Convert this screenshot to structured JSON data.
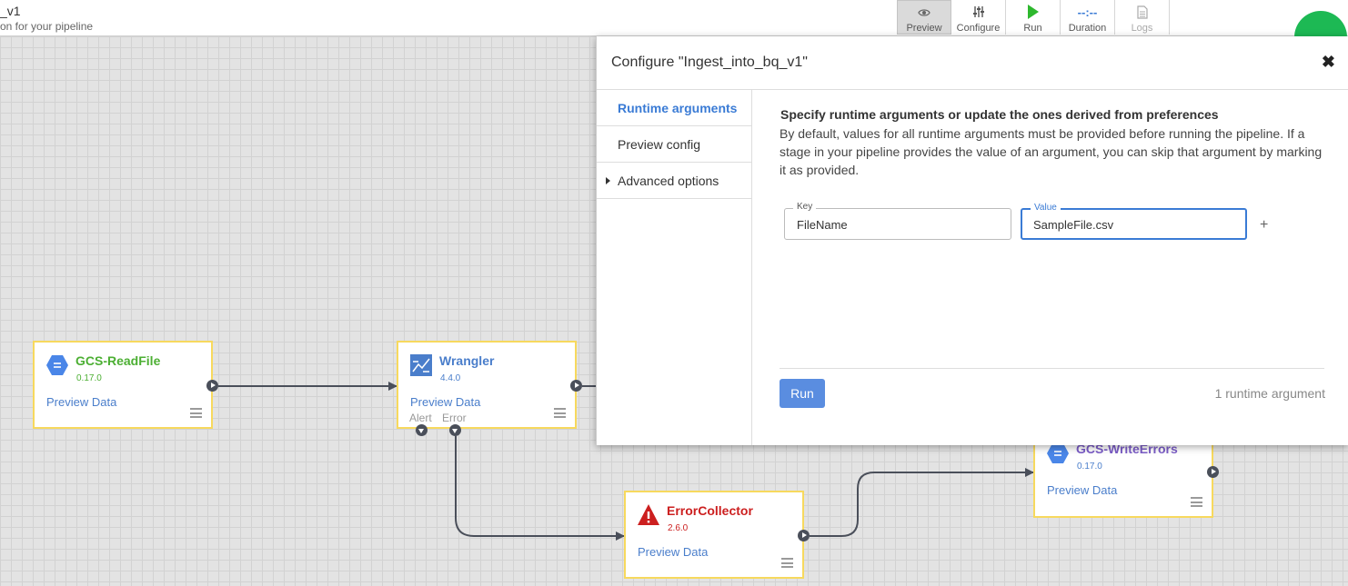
{
  "header": {
    "pipeline_name": "_v1",
    "pipeline_description": "on for your pipeline"
  },
  "toolbar": {
    "items": [
      {
        "label": "Preview",
        "icon": "eye-icon",
        "active": true
      },
      {
        "label": "Configure",
        "icon": "sliders-icon",
        "active": false
      },
      {
        "label": "Run",
        "icon": "play-icon",
        "active": false
      },
      {
        "label": "Duration",
        "icon": "duration-text",
        "value": "--:--",
        "active": false
      },
      {
        "label": "Logs",
        "icon": "document-icon",
        "active": false,
        "disabled": true
      }
    ]
  },
  "canvas": {
    "nodes": [
      {
        "name": "GCS-ReadFile",
        "version": "0.17.0",
        "preview": "Preview Data",
        "color": "#4caf33",
        "icon": "gcs-hexagon-icon"
      },
      {
        "name": "Wrangler",
        "version": "4.4.0",
        "preview": "Preview Data",
        "color": "#4a7ecb",
        "icon": "wrangler-icon",
        "alert_label": "Alert",
        "error_label": "Error"
      },
      {
        "name": "ErrorCollector",
        "version": "2.6.0",
        "preview": "Preview Data",
        "color": "#cc1f1f",
        "icon": "warning-triangle-icon"
      },
      {
        "name": "GCS-WriteErrors",
        "version": "0.17.0",
        "preview": "Preview Data",
        "color": "#7b5cc7",
        "icon": "gcs-hexagon-icon"
      }
    ]
  },
  "modal": {
    "title": "Configure \"Ingest_into_bq_v1\"",
    "sidebar": [
      {
        "label": "Runtime arguments",
        "active": true
      },
      {
        "label": "Preview config",
        "active": false
      },
      {
        "label": "Advanced options",
        "active": false,
        "expandable": true
      }
    ],
    "heading": "Specify runtime arguments or update the ones derived from preferences",
    "description": "By default, values for all runtime arguments must be provided before running the pipeline. If a stage in your pipeline provides the value of an argument, you can skip that argument by marking it as provided.",
    "key_label": "Key",
    "key_value": "FileName",
    "value_label": "Value",
    "value_value": "SampleFile.csv",
    "add": "+",
    "run_label": "Run",
    "count_label": "1 runtime argument"
  },
  "colors": {
    "accent": "#3a7bd5",
    "node_border": "#f7d95e",
    "run_button": "#5a8de0",
    "avatar": "#1db954"
  }
}
